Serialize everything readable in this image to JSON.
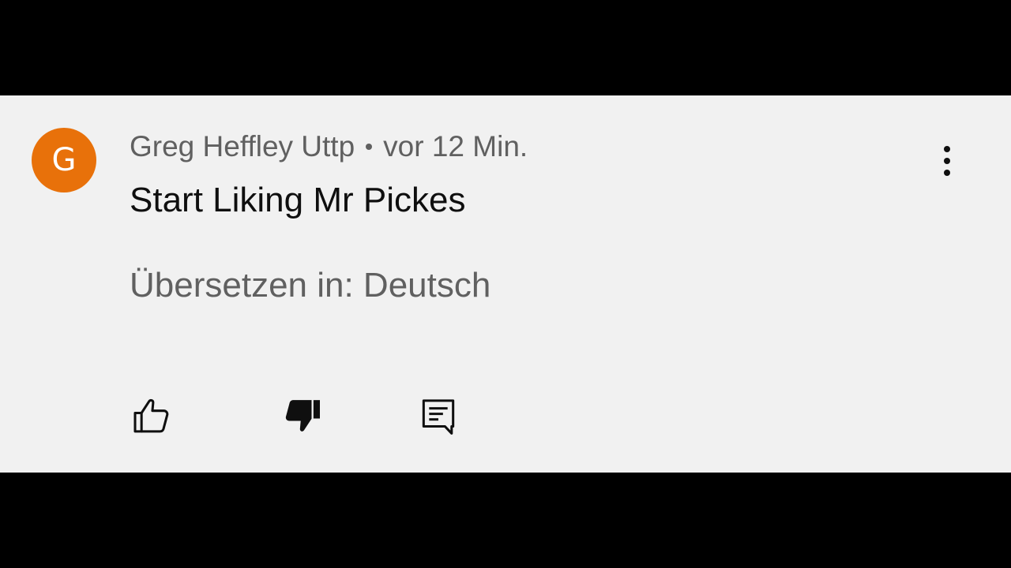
{
  "comment": {
    "author": "Greg Heffley Uttp",
    "timestamp": "vor 12 Min.",
    "text": "Start Liking Mr Pickes",
    "avatar_initial": "G",
    "avatar_color": "#e8710a",
    "translate_label": "Übersetzen in: Deutsch",
    "disliked": true
  },
  "icons": {
    "more": "more-vertical-icon",
    "like": "thumb-up-outline-icon",
    "dislike": "thumb-down-filled-icon",
    "reply": "reply-comment-icon"
  }
}
